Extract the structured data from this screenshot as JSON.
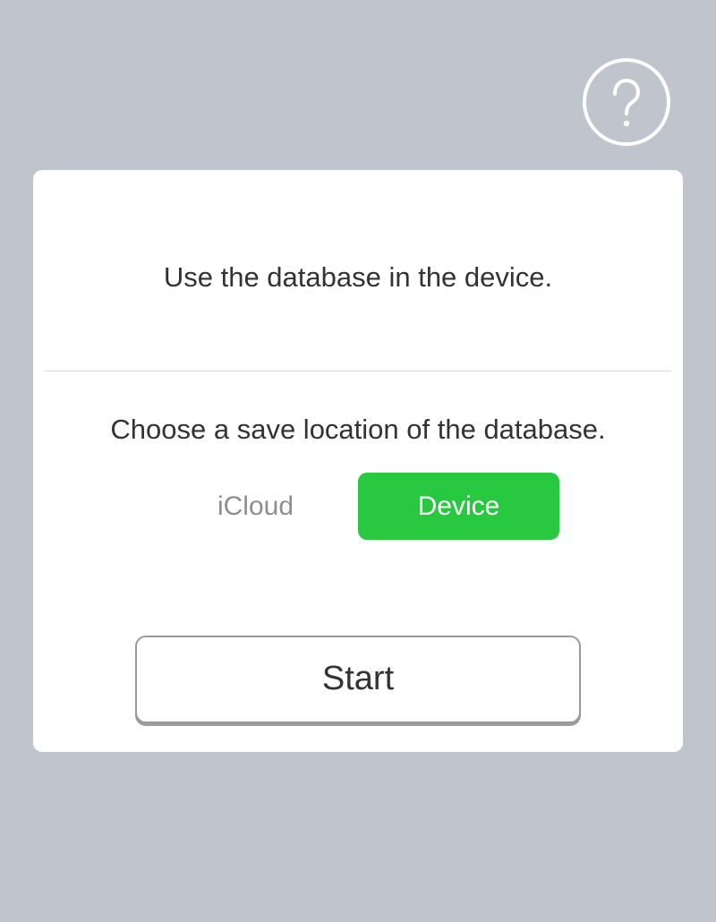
{
  "help": {
    "icon": "question-mark-icon"
  },
  "card": {
    "info_text": "Use the database in the device.",
    "choose_text": "Choose a save location of the database.",
    "options": [
      {
        "label": "iCloud",
        "selected": false
      },
      {
        "label": "Device",
        "selected": true
      }
    ],
    "start_label": "Start"
  },
  "colors": {
    "background": "#c0c4cd",
    "card": "#ffffff",
    "selected_option": "#28c840",
    "text": "#333333",
    "unselected_option_text": "#8e8e8e"
  }
}
